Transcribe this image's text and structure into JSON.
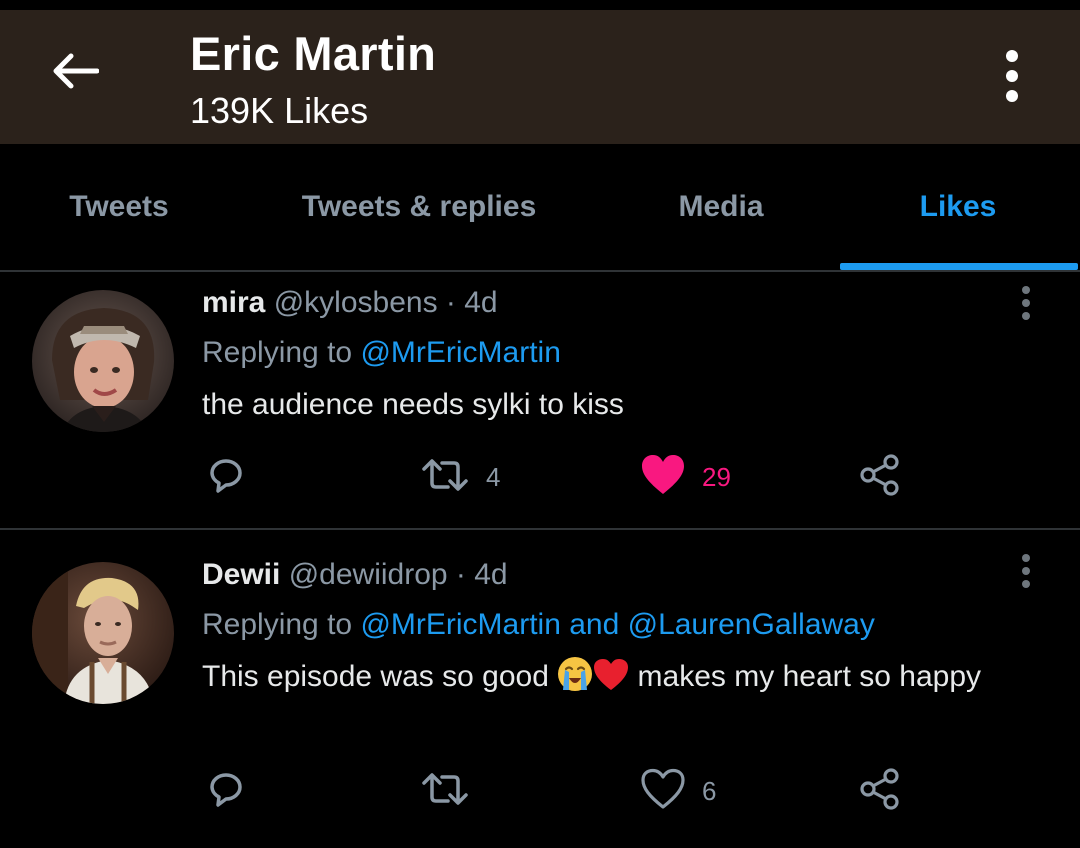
{
  "header": {
    "title": "Eric Martin",
    "subtitle": "139K Likes"
  },
  "tabs": [
    {
      "label": "Tweets",
      "active": false
    },
    {
      "label": "Tweets & replies",
      "active": false
    },
    {
      "label": "Media",
      "active": false
    },
    {
      "label": "Likes",
      "active": true
    }
  ],
  "tweets": [
    {
      "name": "mira",
      "handle": "@kylosbens",
      "time": "4d",
      "replying_prefix": "Replying to ",
      "replying_to": "@MrEricMartin",
      "text": "the audience needs sylki to kiss",
      "retweets": "4",
      "likes": "29",
      "liked": true
    },
    {
      "name": "Dewii",
      "handle": "@dewiidrop",
      "time": "4d",
      "replying_prefix": "Replying to ",
      "replying_to": "@MrEricMartin and @LaurenGallaway",
      "text_before_emoji": "This episode was so good ",
      "text_after_emoji": " makes my heart so happy",
      "emojis": [
        "loudly-crying-face-icon",
        "red-heart-icon"
      ],
      "retweets": "",
      "likes": "6",
      "liked": false
    }
  ],
  "colors": {
    "header_bg": "#2b221b",
    "accent_blue": "#1d9bf0",
    "like_pink": "#f91880",
    "muted_gray": "#8b98a5"
  }
}
